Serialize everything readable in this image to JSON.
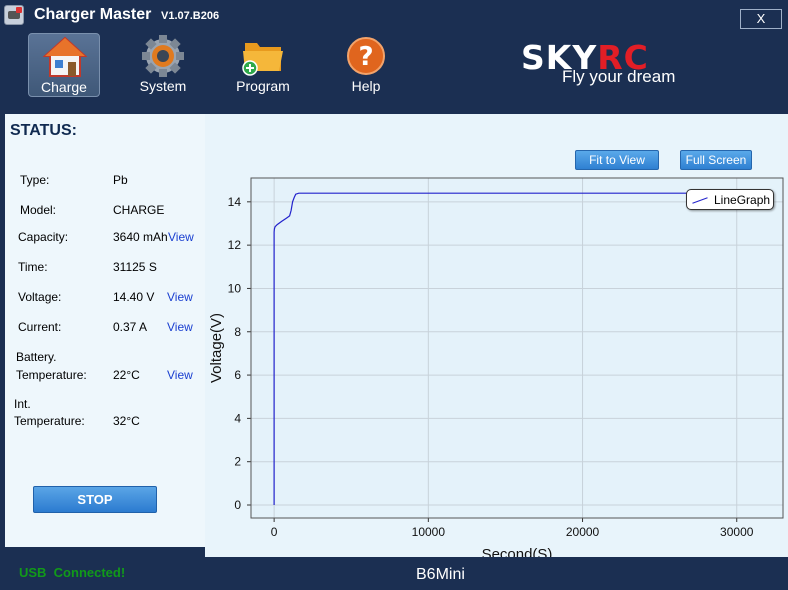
{
  "app": {
    "title": "Charger Master",
    "version": "V1.07.B206",
    "close_label": "X"
  },
  "toolbar": {
    "items": [
      {
        "label": "Charge",
        "icon": "home-icon"
      },
      {
        "label": "System",
        "icon": "gear-icon"
      },
      {
        "label": "Program",
        "icon": "folder-add-icon"
      },
      {
        "label": "Help",
        "icon": "help-icon"
      }
    ],
    "active": "Charge"
  },
  "brand": {
    "logo_left": "SKY",
    "logo_right": "RC",
    "tagline": "Fly your dream"
  },
  "status": {
    "heading": "STATUS:",
    "type": {
      "label": "Type:",
      "value": "Pb"
    },
    "model": {
      "label": "Model:",
      "value": "CHARGE"
    },
    "capacity": {
      "label": "Capacity:",
      "value": "3640 mAh",
      "view": "View"
    },
    "time": {
      "label": "Time:",
      "value": "31125 S"
    },
    "voltage": {
      "label": "Voltage:",
      "value": "14.40 V",
      "view": "View"
    },
    "current": {
      "label": "Current:",
      "value": "0.37 A",
      "view": "View"
    },
    "battery_temp": {
      "label_line1": "Battery.",
      "label_line2": "Temperature:",
      "value": "22°C",
      "view": "View"
    },
    "int_temp": {
      "label_line1": "Int.",
      "label_line2": "Temperature:",
      "value": "32°C"
    },
    "stop_label": "STOP"
  },
  "graph": {
    "fit_label": "Fit to View",
    "full_label": "Full Screen"
  },
  "chart_data": {
    "type": "line",
    "xlabel": "Second(S)",
    "ylabel": "Voltage(V)",
    "xlim": [
      -1500,
      33000
    ],
    "ylim": [
      -0.6,
      15.1
    ],
    "xticks": [
      0,
      10000,
      20000,
      30000
    ],
    "yticks": [
      0,
      2,
      4,
      6,
      8,
      10,
      12,
      14
    ],
    "grid": true,
    "legend_position": "top-right",
    "series": [
      {
        "name": "LineGraph",
        "color": "#2222cc",
        "x": [
          0,
          0,
          20,
          60,
          200,
          500,
          800,
          1000,
          1100,
          1200,
          1300,
          1400,
          1600,
          5000,
          10000,
          20000,
          30000,
          31125
        ],
        "y": [
          0,
          12.6,
          12.75,
          12.85,
          12.95,
          13.1,
          13.25,
          13.35,
          13.6,
          14.0,
          14.2,
          14.35,
          14.4,
          14.4,
          14.4,
          14.4,
          14.4,
          14.4
        ]
      }
    ]
  },
  "footer": {
    "connection": "USB  Connected!",
    "device": "B6Mini"
  },
  "colors": {
    "frame": "#1b2f52",
    "panel": "#eef7fc",
    "graph_bg": "#e8f4fb",
    "plot_bg": "#e4f2fa",
    "line": "#2222cc",
    "usb_green": "#119a19",
    "link_blue": "#1a3fd0"
  }
}
